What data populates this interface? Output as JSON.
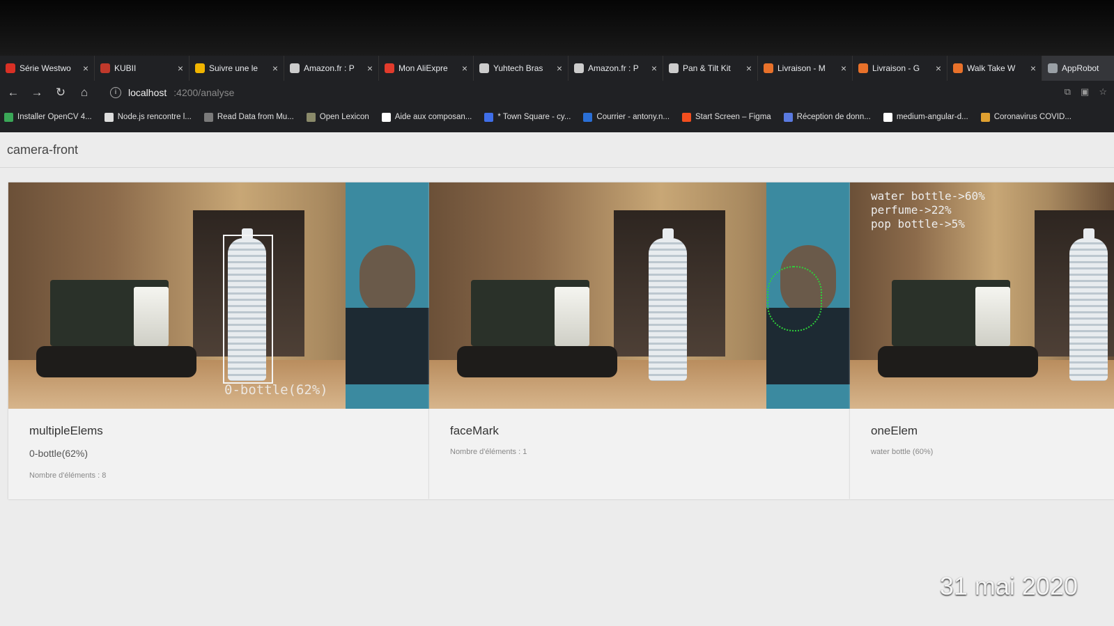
{
  "tabs": [
    {
      "label": "Série Westwo",
      "color": "#d93025"
    },
    {
      "label": "KUBII",
      "color": "#c0392b"
    },
    {
      "label": "Suivre une le",
      "color": "#f0b400"
    },
    {
      "label": "Amazon.fr : P",
      "color": "#cccccc"
    },
    {
      "label": "Mon AliExpre",
      "color": "#e23b2c"
    },
    {
      "label": "Yuhtech Bras",
      "color": "#cccccc"
    },
    {
      "label": "Amazon.fr : P",
      "color": "#cccccc"
    },
    {
      "label": "Pan & Tilt Kit",
      "color": "#cccccc"
    },
    {
      "label": "Livraison - M",
      "color": "#e8712a"
    },
    {
      "label": "Livraison - G",
      "color": "#e8712a"
    },
    {
      "label": "Walk Take W",
      "color": "#e8712a"
    },
    {
      "label": "AppRobot",
      "color": "#9aa0a6"
    }
  ],
  "tab_close": "×",
  "omnibox": {
    "host": "localhost",
    "path": ":4200/analyse"
  },
  "bookmarks": [
    {
      "label": "Installer OpenCV 4...",
      "color": "#3aa757"
    },
    {
      "label": "Node.js rencontre l...",
      "color": "#dddddd"
    },
    {
      "label": "Read Data from Mu...",
      "color": "#7a7a7a"
    },
    {
      "label": "Open Lexicon",
      "color": "#8a8a6a"
    },
    {
      "label": "Aide aux composan...",
      "color": "#ffffff"
    },
    {
      "label": "* Town Square - cy...",
      "color": "#3f6ee8"
    },
    {
      "label": "Courrier - antony.n...",
      "color": "#2a6fd6"
    },
    {
      "label": "Start Screen – Figma",
      "color": "#f24e1e"
    },
    {
      "label": "Réception de donn...",
      "color": "#5a7ae0"
    },
    {
      "label": "medium-angular-d...",
      "color": "#ffffff"
    },
    {
      "label": "Coronavirus COVID...",
      "color": "#e0a030"
    }
  ],
  "page": {
    "title": "camera-front"
  },
  "cards": [
    {
      "title": "multipleElems",
      "detail": "0-bottle(62%)",
      "count": "Nombre d'éléments : 8",
      "overlay_label": "0-bottle(62%)"
    },
    {
      "title": "faceMark",
      "detail": "",
      "count": "Nombre d'éléments : 1"
    },
    {
      "title": "oneElem",
      "detail": "",
      "count": "water bottle (60%)",
      "overlay_text": "water bottle->60%\nperfume->22%\npop bottle->5%"
    }
  ],
  "photo_date": "31 mai 2020"
}
